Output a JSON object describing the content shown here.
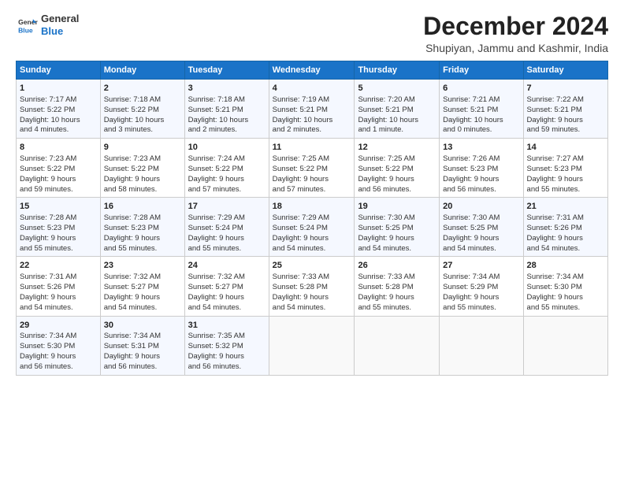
{
  "logo": {
    "line1": "General",
    "line2": "Blue"
  },
  "header": {
    "month": "December 2024",
    "location": "Shupiyan, Jammu and Kashmir, India"
  },
  "days_of_week": [
    "Sunday",
    "Monday",
    "Tuesday",
    "Wednesday",
    "Thursday",
    "Friday",
    "Saturday"
  ],
  "weeks": [
    [
      {
        "day": 1,
        "info": "Sunrise: 7:17 AM\nSunset: 5:22 PM\nDaylight: 10 hours\nand 4 minutes."
      },
      {
        "day": 2,
        "info": "Sunrise: 7:18 AM\nSunset: 5:22 PM\nDaylight: 10 hours\nand 3 minutes."
      },
      {
        "day": 3,
        "info": "Sunrise: 7:18 AM\nSunset: 5:21 PM\nDaylight: 10 hours\nand 2 minutes."
      },
      {
        "day": 4,
        "info": "Sunrise: 7:19 AM\nSunset: 5:21 PM\nDaylight: 10 hours\nand 2 minutes."
      },
      {
        "day": 5,
        "info": "Sunrise: 7:20 AM\nSunset: 5:21 PM\nDaylight: 10 hours\nand 1 minute."
      },
      {
        "day": 6,
        "info": "Sunrise: 7:21 AM\nSunset: 5:21 PM\nDaylight: 10 hours\nand 0 minutes."
      },
      {
        "day": 7,
        "info": "Sunrise: 7:22 AM\nSunset: 5:21 PM\nDaylight: 9 hours\nand 59 minutes."
      }
    ],
    [
      {
        "day": 8,
        "info": "Sunrise: 7:23 AM\nSunset: 5:22 PM\nDaylight: 9 hours\nand 59 minutes."
      },
      {
        "day": 9,
        "info": "Sunrise: 7:23 AM\nSunset: 5:22 PM\nDaylight: 9 hours\nand 58 minutes."
      },
      {
        "day": 10,
        "info": "Sunrise: 7:24 AM\nSunset: 5:22 PM\nDaylight: 9 hours\nand 57 minutes."
      },
      {
        "day": 11,
        "info": "Sunrise: 7:25 AM\nSunset: 5:22 PM\nDaylight: 9 hours\nand 57 minutes."
      },
      {
        "day": 12,
        "info": "Sunrise: 7:25 AM\nSunset: 5:22 PM\nDaylight: 9 hours\nand 56 minutes."
      },
      {
        "day": 13,
        "info": "Sunrise: 7:26 AM\nSunset: 5:23 PM\nDaylight: 9 hours\nand 56 minutes."
      },
      {
        "day": 14,
        "info": "Sunrise: 7:27 AM\nSunset: 5:23 PM\nDaylight: 9 hours\nand 55 minutes."
      }
    ],
    [
      {
        "day": 15,
        "info": "Sunrise: 7:28 AM\nSunset: 5:23 PM\nDaylight: 9 hours\nand 55 minutes."
      },
      {
        "day": 16,
        "info": "Sunrise: 7:28 AM\nSunset: 5:23 PM\nDaylight: 9 hours\nand 55 minutes."
      },
      {
        "day": 17,
        "info": "Sunrise: 7:29 AM\nSunset: 5:24 PM\nDaylight: 9 hours\nand 55 minutes."
      },
      {
        "day": 18,
        "info": "Sunrise: 7:29 AM\nSunset: 5:24 PM\nDaylight: 9 hours\nand 54 minutes."
      },
      {
        "day": 19,
        "info": "Sunrise: 7:30 AM\nSunset: 5:25 PM\nDaylight: 9 hours\nand 54 minutes."
      },
      {
        "day": 20,
        "info": "Sunrise: 7:30 AM\nSunset: 5:25 PM\nDaylight: 9 hours\nand 54 minutes."
      },
      {
        "day": 21,
        "info": "Sunrise: 7:31 AM\nSunset: 5:26 PM\nDaylight: 9 hours\nand 54 minutes."
      }
    ],
    [
      {
        "day": 22,
        "info": "Sunrise: 7:31 AM\nSunset: 5:26 PM\nDaylight: 9 hours\nand 54 minutes."
      },
      {
        "day": 23,
        "info": "Sunrise: 7:32 AM\nSunset: 5:27 PM\nDaylight: 9 hours\nand 54 minutes."
      },
      {
        "day": 24,
        "info": "Sunrise: 7:32 AM\nSunset: 5:27 PM\nDaylight: 9 hours\nand 54 minutes."
      },
      {
        "day": 25,
        "info": "Sunrise: 7:33 AM\nSunset: 5:28 PM\nDaylight: 9 hours\nand 54 minutes."
      },
      {
        "day": 26,
        "info": "Sunrise: 7:33 AM\nSunset: 5:28 PM\nDaylight: 9 hours\nand 55 minutes."
      },
      {
        "day": 27,
        "info": "Sunrise: 7:34 AM\nSunset: 5:29 PM\nDaylight: 9 hours\nand 55 minutes."
      },
      {
        "day": 28,
        "info": "Sunrise: 7:34 AM\nSunset: 5:30 PM\nDaylight: 9 hours\nand 55 minutes."
      }
    ],
    [
      {
        "day": 29,
        "info": "Sunrise: 7:34 AM\nSunset: 5:30 PM\nDaylight: 9 hours\nand 56 minutes."
      },
      {
        "day": 30,
        "info": "Sunrise: 7:34 AM\nSunset: 5:31 PM\nDaylight: 9 hours\nand 56 minutes."
      },
      {
        "day": 31,
        "info": "Sunrise: 7:35 AM\nSunset: 5:32 PM\nDaylight: 9 hours\nand 56 minutes."
      },
      null,
      null,
      null,
      null
    ]
  ]
}
